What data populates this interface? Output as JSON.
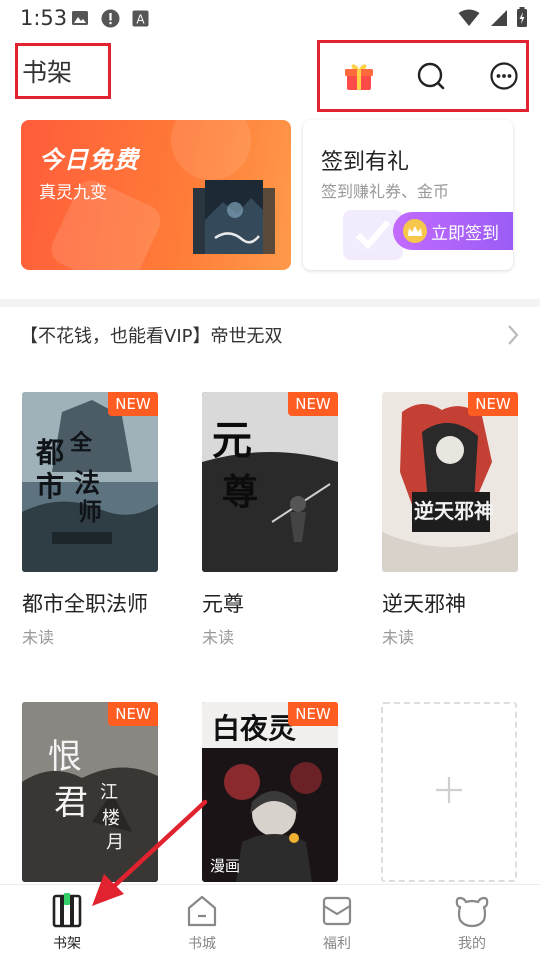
{
  "status": {
    "time": "1:53"
  },
  "header": {
    "title": "书架",
    "icons": [
      "gift-icon",
      "search-icon",
      "more-icon"
    ]
  },
  "free_card": {
    "title": "今日免费",
    "subtitle": "真灵九变"
  },
  "sign_card": {
    "title": "签到有礼",
    "subtitle": "签到赚礼券、金币",
    "button": "立即签到"
  },
  "promo": {
    "text": "【不花钱，也能看VIP】帝世无双"
  },
  "books": [
    {
      "title": "都市全职法师",
      "status": "未读",
      "badge": "NEW",
      "cover_color": "#4f6a74"
    },
    {
      "title": "元尊",
      "status": "未读",
      "badge": "NEW",
      "cover_color": "#1b1b1b"
    },
    {
      "title": "逆天邪神",
      "status": "未读",
      "badge": "NEW",
      "cover_color": "#e9e4de"
    },
    {
      "title": "",
      "status": "",
      "badge": "NEW",
      "cover_color": "#3b3b3b"
    },
    {
      "title": "",
      "status": "",
      "badge": "NEW",
      "cover_color": "#1a1416",
      "caption": "漫画"
    }
  ],
  "tabs": [
    {
      "label": "书架",
      "active": true
    },
    {
      "label": "书城",
      "active": false
    },
    {
      "label": "福利",
      "active": false
    },
    {
      "label": "我的",
      "active": false
    }
  ],
  "colors": {
    "accent": "#ff5c21",
    "highlight_box": "#e1232f",
    "sign_button": "#9a5cf5"
  }
}
